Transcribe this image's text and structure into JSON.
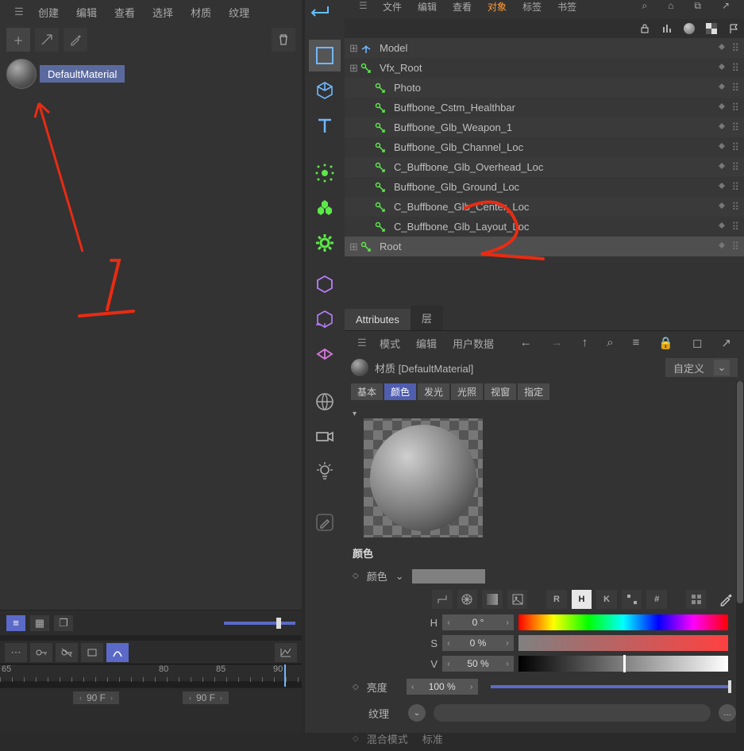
{
  "left_menu": {
    "items": [
      "创建",
      "编辑",
      "查看",
      "选择",
      "材质",
      "纹理"
    ]
  },
  "material": {
    "name": "DefaultMaterial"
  },
  "rt_menu": {
    "items": [
      "文件",
      "编辑",
      "查看",
      "对象",
      "标签",
      "书签"
    ],
    "active_index": 3
  },
  "objects": [
    {
      "label": "Model",
      "indent": 0,
      "expando": "+",
      "icon": "axis"
    },
    {
      "label": "Vfx_Root",
      "indent": 0,
      "expando": "+",
      "icon": "null-green"
    },
    {
      "label": "Photo",
      "indent": 1,
      "expando": "",
      "icon": "null-green"
    },
    {
      "label": "Buffbone_Cstm_Healthbar",
      "indent": 1,
      "expando": "",
      "icon": "null-green"
    },
    {
      "label": "Buffbone_Glb_Weapon_1",
      "indent": 1,
      "expando": "",
      "icon": "null-green"
    },
    {
      "label": "Buffbone_Glb_Channel_Loc",
      "indent": 1,
      "expando": "",
      "icon": "null-green"
    },
    {
      "label": "C_Buffbone_Glb_Overhead_Loc",
      "indent": 1,
      "expando": "",
      "icon": "null-green"
    },
    {
      "label": "Buffbone_Glb_Ground_Loc",
      "indent": 1,
      "expando": "",
      "icon": "null-green"
    },
    {
      "label": "C_Buffbone_Glb_Center_Loc",
      "indent": 1,
      "expando": "",
      "icon": "null-green"
    },
    {
      "label": "C_Buffbone_Glb_Layout_Loc",
      "indent": 1,
      "expando": "",
      "icon": "null-green"
    },
    {
      "label": "Root",
      "indent": 0,
      "expando": "+",
      "icon": "null-green",
      "selected": true
    }
  ],
  "attr_tabs": {
    "main": [
      "Attributes",
      "层"
    ],
    "active_main": 0
  },
  "attr_menu": {
    "items": [
      "模式",
      "编辑",
      "用户数据"
    ]
  },
  "mat_header": {
    "title": "材质 [DefaultMaterial]",
    "dropdown": "自定义"
  },
  "attr_subtabs": {
    "items": [
      "基本",
      "颜色",
      "发光",
      "光照",
      "视窗",
      "指定"
    ],
    "active_index": 1
  },
  "color_section": {
    "header": "颜色",
    "label": "颜色"
  },
  "mode_buttons": [
    "R",
    "H",
    "K"
  ],
  "hsv": {
    "h": {
      "label": "H",
      "value": "0 °"
    },
    "s": {
      "label": "S",
      "value": "0 %"
    },
    "v": {
      "label": "V",
      "value": "50 %",
      "handle_pct": 50
    }
  },
  "brightness": {
    "label": "亮度",
    "value": "100 %"
  },
  "texture": {
    "label": "纹理"
  },
  "blend": {
    "label": "混合模式",
    "value": "标准"
  },
  "ruler": {
    "ticks": [
      65,
      80,
      85,
      90
    ]
  },
  "frames": {
    "f1": "90 F",
    "f2": "90 F"
  }
}
